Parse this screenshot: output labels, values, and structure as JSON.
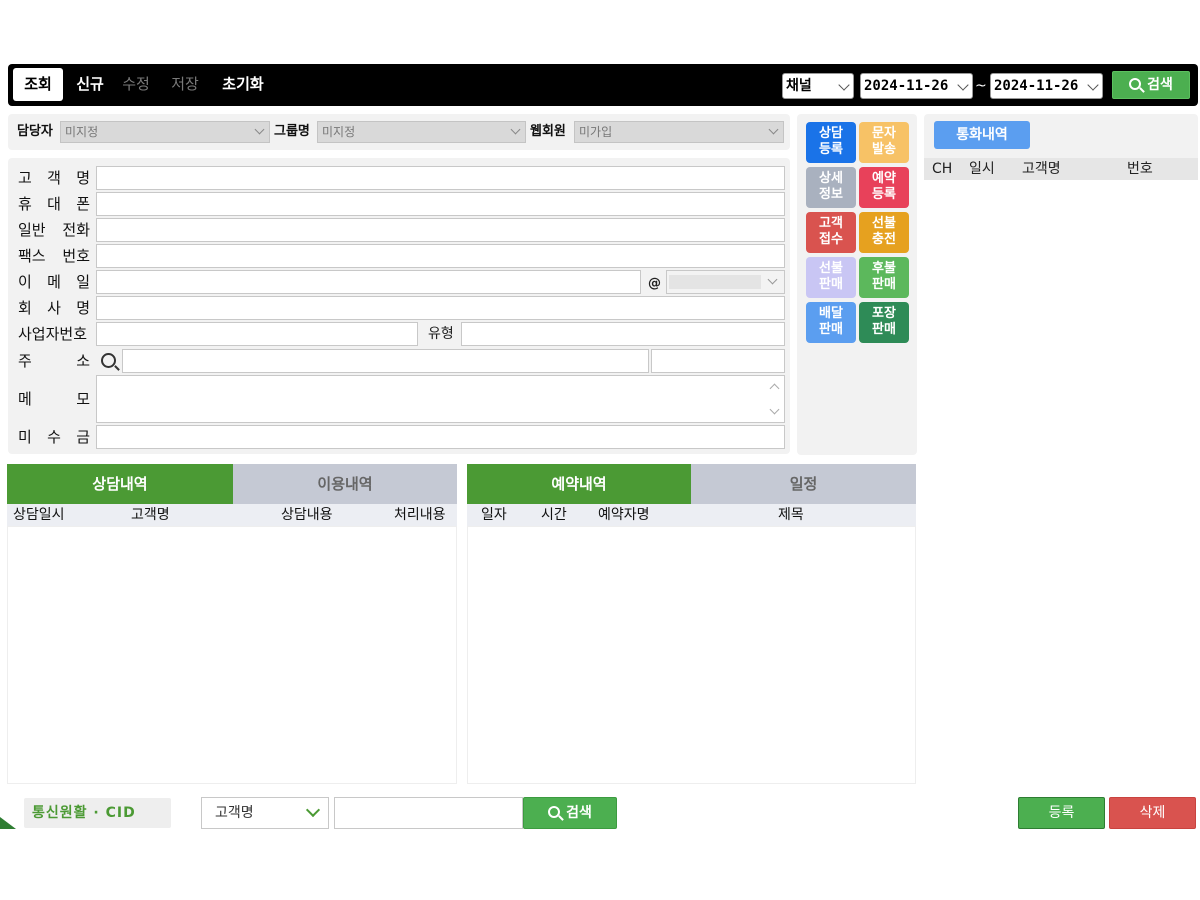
{
  "toolbar": {
    "view": "조회",
    "new": "신규",
    "edit": "수정",
    "save": "저장",
    "reset": "초기화",
    "channel": "채널",
    "date_from": "2024-11-26",
    "tilde": "~",
    "date_to": "2024-11-26",
    "search": "검색"
  },
  "filters": {
    "manager_label": "담당자",
    "manager_value": "미지정",
    "group_label": "그룹명",
    "group_value": "미지정",
    "web_label": "웹회원",
    "web_value": "미가입"
  },
  "form": {
    "name_chars": [
      "고",
      "객",
      "명"
    ],
    "mobile_chars": [
      "휴",
      "대",
      "폰"
    ],
    "phone_chars": [
      "일반",
      "전화"
    ],
    "fax_chars": [
      "팩스",
      "번호"
    ],
    "email_chars": [
      "이",
      "메",
      "일"
    ],
    "company_chars": [
      "회",
      "사",
      "명"
    ],
    "bizno_chars": [
      "사업자번호"
    ],
    "address_chars": [
      "주",
      "소"
    ],
    "memo_chars": [
      "메",
      "모"
    ],
    "unpaid_chars": [
      "미",
      "수",
      "금"
    ],
    "at_sign": "@",
    "type_label": "유형"
  },
  "actions": [
    {
      "line1": "상담",
      "line2": "등록",
      "color": "#1a73e8"
    },
    {
      "line1": "문자",
      "line2": "발송",
      "color": "#f7c266"
    },
    {
      "line1": "상세",
      "line2": "정보",
      "color": "#a9b1bf"
    },
    {
      "line1": "예약",
      "line2": "등록",
      "color": "#e8415a"
    },
    {
      "line1": "고객",
      "line2": "접수",
      "color": "#d9534f"
    },
    {
      "line1": "선불",
      "line2": "충전",
      "color": "#e6a11f"
    },
    {
      "line1": "선불",
      "line2": "판매",
      "color": "#c9c6f4"
    },
    {
      "line1": "후불",
      "line2": "판매",
      "color": "#5cb85c"
    },
    {
      "line1": "배달",
      "line2": "판매",
      "color": "#5b9ef0"
    },
    {
      "line1": "포장",
      "line2": "판매",
      "color": "#2e8b57"
    }
  ],
  "calls": {
    "tab": "통화내역",
    "col_ch": "CH",
    "col_time": "일시",
    "col_name": "고객명",
    "col_number": "번호"
  },
  "consult": {
    "tab_on": "상담내역",
    "tab_off": "이용내역",
    "col_date": "상담일시",
    "col_name": "고객명",
    "col_content": "상담내용",
    "col_result": "처리내용"
  },
  "reserve": {
    "tab_on": "예약내역",
    "tab_off": "일정",
    "col_date": "일자",
    "col_time": "시간",
    "col_name": "예약자명",
    "col_title": "제목"
  },
  "bottom": {
    "status": "통신원활 · CID",
    "search_field": "고객명",
    "search_placeholder": "",
    "search": "검색",
    "register": "등록",
    "delete": "삭제"
  }
}
